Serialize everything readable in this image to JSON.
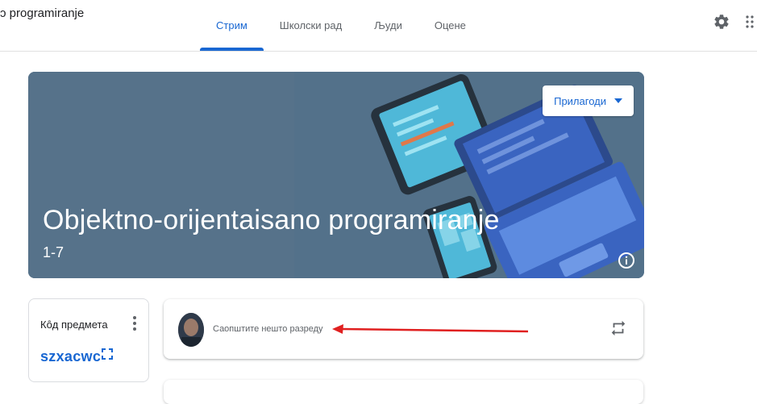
{
  "app": {
    "title": "ɔ programiranje"
  },
  "tabs": [
    {
      "label": "Стрим",
      "active": true
    },
    {
      "label": "Школски рад",
      "active": false
    },
    {
      "label": "Људи",
      "active": false
    },
    {
      "label": "Оцене",
      "active": false
    }
  ],
  "header_icons": {
    "settings": "gear-icon",
    "apps": "apps-grid-icon"
  },
  "banner": {
    "title": "Objektno-orijentaisano programiranje",
    "section": "1-7",
    "customize_label": "Прилагоди",
    "info_icon": "info-icon"
  },
  "class_code": {
    "label": "Кȏд предмета",
    "value": "szxacwc"
  },
  "stream": {
    "announce_placeholder": "Саопштите нешто разреду"
  },
  "colors": {
    "accent": "#1967d2",
    "banner_bg": "#4f6f86",
    "annotation_arrow": "#e02020"
  }
}
